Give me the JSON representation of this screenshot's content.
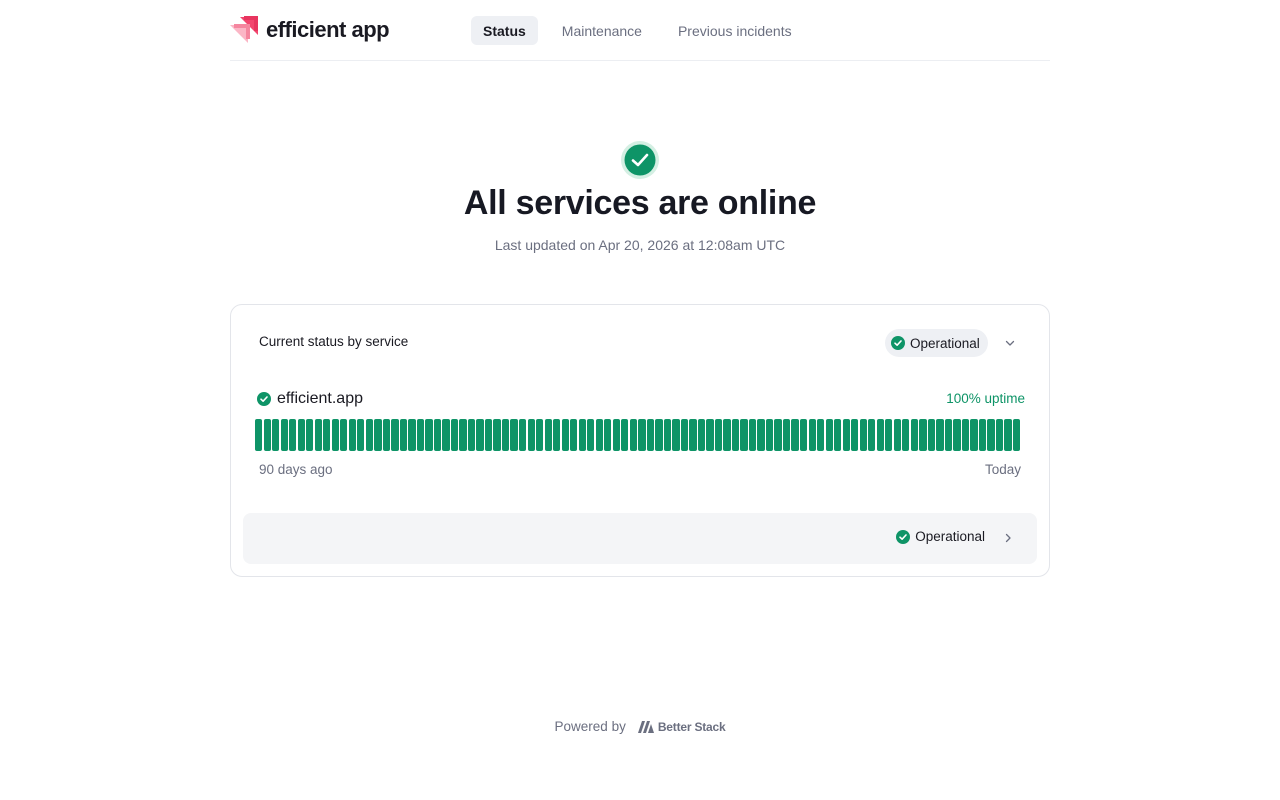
{
  "brand": {
    "name": "efficient app"
  },
  "nav": {
    "tabs": [
      {
        "label": "Status",
        "active": true
      },
      {
        "label": "Maintenance",
        "active": false
      },
      {
        "label": "Previous incidents",
        "active": false
      }
    ]
  },
  "hero": {
    "icon": "check-circle-icon",
    "title": "All services are online",
    "subtitle": "Last updated on Apr 20, 2026 at 12:08am UTC"
  },
  "status_card": {
    "title": "Current status by service",
    "overall_status": "Operational",
    "service": {
      "name": "efficient.app",
      "uptime": "100% uptime",
      "days": 90,
      "range_start": "90 days ago",
      "range_end": "Today"
    },
    "group_row": {
      "status": "Operational"
    }
  },
  "footer": {
    "powered_by": "Powered by",
    "vendor": "Better Stack"
  },
  "colors": {
    "operational": "#0e9467",
    "text_primary": "#171923",
    "text_muted": "#6b6f80",
    "brand_pink": "#f2466e"
  }
}
